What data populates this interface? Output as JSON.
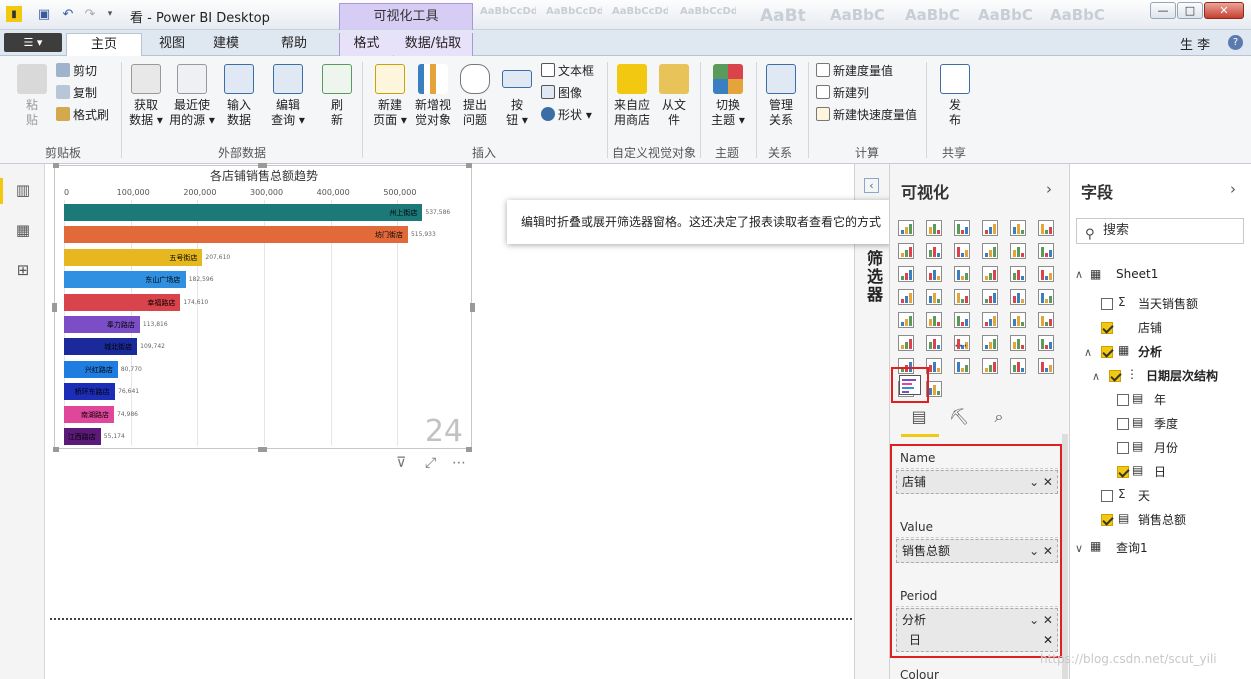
{
  "titlebar": {
    "title": "看 - Power BI Desktop",
    "context_tab": "可视化工具",
    "style_gallery": [
      "AaBbCcDd",
      "AaBbCcDd",
      "AaBbCcDd",
      "AaBbCcDd",
      "AaBt",
      "AaBbC",
      "AaBbC",
      "AaBbC",
      "AaBbC",
      "AaBbC"
    ]
  },
  "tabs": {
    "file": "☰ ▾",
    "items": [
      "主页",
      "视图",
      "建模",
      "帮助",
      "格式",
      "数据/钻取"
    ],
    "user": "生 李"
  },
  "ribbon": {
    "clipboard": {
      "paste": "粘\n贴",
      "cut": "剪切",
      "copy": "复制",
      "format_painter": "格式刷",
      "label": "剪贴板"
    },
    "data": {
      "get_data": "获取\n数据 ▾",
      "recent": "最近使\n用的源 ▾",
      "enter": "输入\n数据",
      "edit_query": "编辑\n查询 ▾",
      "refresh": "刷\n新",
      "label": "外部数据"
    },
    "insert": {
      "new_page": "新建\n页面 ▾",
      "new_visual": "新增视\n觉对象",
      "ask": "提出\n问题",
      "buttons": "按\n钮 ▾",
      "textbox": "文本框",
      "image": "图像",
      "shapes": "形状 ▾",
      "label": "插入"
    },
    "custom": {
      "store": "来自应\n用商店",
      "file": "从文\n件",
      "label": "自定义视觉对象"
    },
    "theme": {
      "switch": "切换\n主题 ▾",
      "label": "主题"
    },
    "rel": {
      "manage": "管理\n关系",
      "label": "关系"
    },
    "calc": {
      "measure": "新建度量值",
      "column": "新建列",
      "quick": "新建快速度量值",
      "label": "计算"
    },
    "share": {
      "publish": "发\n布",
      "label": "共享"
    }
  },
  "chart_data": {
    "type": "bar",
    "title": "各店铺销售总额趋势",
    "ticks": [
      "0",
      "100,000",
      "200,000",
      "300,000",
      "400,000",
      "500,000"
    ],
    "xlim": [
      0,
      600000
    ],
    "categories": [
      "州上街店",
      "坊门街店",
      "五号街店",
      "东山广场店",
      "幸福路店",
      "奉力路店",
      "城北街店",
      "兴红路店",
      "桥环东路店",
      "南湖路店",
      "江西路店"
    ],
    "values": [
      537586,
      515933,
      207610,
      182596,
      174610,
      113816,
      109742,
      80770,
      76641,
      74986,
      55174
    ],
    "value_labels": [
      "537,586",
      "515,933",
      "207,610",
      "182,596",
      "174,610",
      "113,816",
      "109,742",
      "80,770",
      "76,641",
      "74,986",
      "55,174"
    ],
    "colors": [
      "#1b7a78",
      "#e26a3a",
      "#e6b71e",
      "#2f8fe0",
      "#d9434b",
      "#7b4dc6",
      "#1b2a9a",
      "#1f7ce0",
      "#1c2db8",
      "#e0479a",
      "#5c1a78"
    ],
    "period": "24"
  },
  "canvas": {
    "filter_icon": "⊽",
    "focus_icon": "⤢",
    "more_icon": "⋯"
  },
  "filters": {
    "label": "筛选器",
    "tooltip": "编辑时折叠或展开筛选器窗格。这还决定了报表读取者查看它的方式"
  },
  "viz": {
    "title": "可视化",
    "more": "⋯",
    "wells": [
      {
        "label": "Name",
        "fields": [
          "店铺"
        ]
      },
      {
        "label": "Value",
        "fields": [
          "销售总额"
        ]
      },
      {
        "label": "Period",
        "fields": [
          "分析",
          "日"
        ]
      },
      {
        "label": "Colour",
        "fields": []
      }
    ]
  },
  "fields": {
    "title": "字段",
    "search_placeholder": "搜索",
    "items": [
      {
        "label": "Sheet1",
        "type": "table"
      },
      {
        "label": "当天销售额",
        "type": "sigma"
      },
      {
        "label": "店铺",
        "type": "text"
      },
      {
        "label": "分析",
        "type": "table"
      },
      {
        "label": "日期层次结构",
        "type": "hier"
      },
      {
        "label": "年",
        "type": "cal"
      },
      {
        "label": "季度",
        "type": "cal"
      },
      {
        "label": "月份",
        "type": "cal"
      },
      {
        "label": "日",
        "type": "cal"
      },
      {
        "label": "天",
        "type": "sigma"
      },
      {
        "label": "销售总额",
        "type": "measure"
      },
      {
        "label": "查询1",
        "type": "table"
      }
    ]
  },
  "watermark": "https://blog.csdn.net/scut_yili"
}
